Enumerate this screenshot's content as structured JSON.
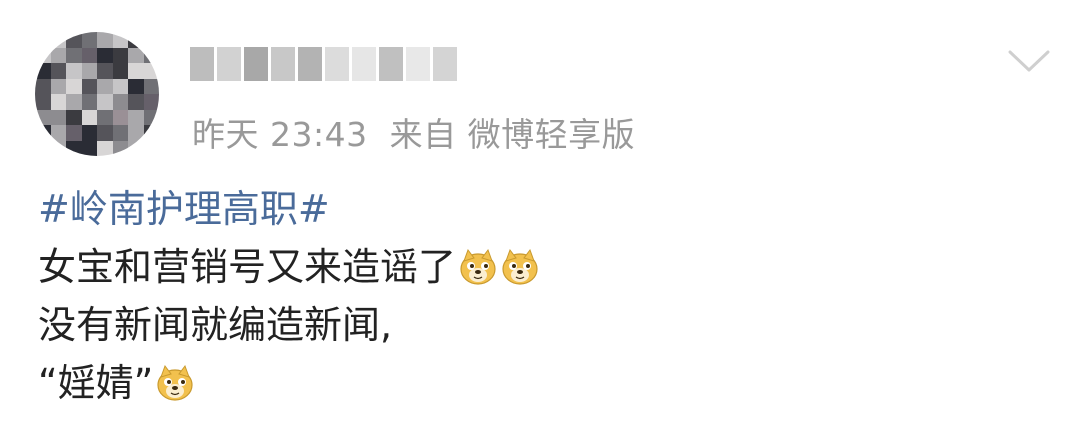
{
  "post": {
    "meta": {
      "time": "昨天 23:43",
      "source": "来自 微博轻享版"
    },
    "topic": "#岭南护理高职#",
    "lines": [
      "女宝和营销号又来造谣了",
      "没有新闻就编造新闻,",
      "“婬婧”"
    ]
  },
  "icons": {
    "avatar": "avatar",
    "menu": "chevron-down-icon",
    "emoji": "doge-emoji-icon"
  },
  "colors": {
    "topic": "#4a6b9a",
    "meta": "#999999",
    "text": "#222222"
  }
}
